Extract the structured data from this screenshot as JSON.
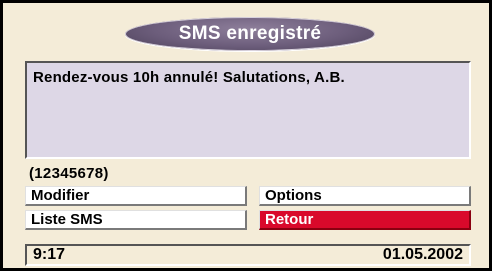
{
  "window": {
    "title": "SMS enregistré"
  },
  "message": {
    "text": "Rendez-vous 10h annulé! Salutations, A.B."
  },
  "sender": {
    "number": "(12345678)"
  },
  "buttons": {
    "modifier": "Modifier",
    "liste_sms": "Liste SMS",
    "options": "Options",
    "retour": "Retour"
  },
  "status": {
    "time": "9:17",
    "date": "01.05.2002"
  },
  "colors": {
    "background": "#f4ecd8",
    "title_pill": "#6c5d7b",
    "message_box": "#ddd7e6",
    "selected_button": "#d9092b"
  }
}
